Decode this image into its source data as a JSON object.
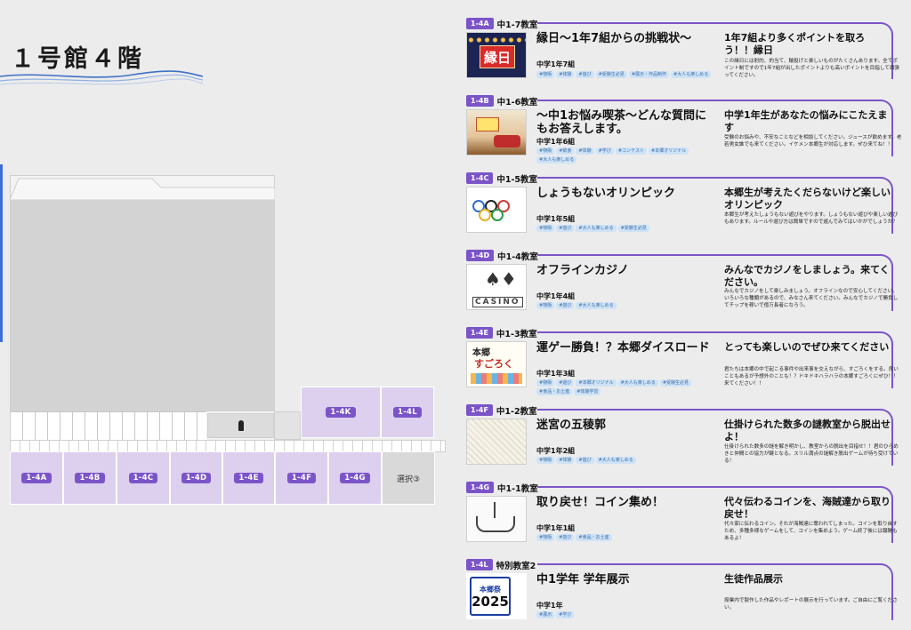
{
  "floor": {
    "title": "１号館４階"
  },
  "map": {
    "rooms_bottom": [
      "1-4A",
      "1-4B",
      "1-4C",
      "1-4D",
      "1-4E",
      "1-4F",
      "1-4G"
    ],
    "rooms_top": [
      "1-4K",
      "1-4L"
    ],
    "selection_room": "選択③"
  },
  "events": [
    {
      "code": "1-4A",
      "room": "中1-7教室",
      "title": "縁日〜1年7組からの挑戦状〜",
      "class": "中学1年7組",
      "tags": [
        "#物販",
        "#体験",
        "#遊び",
        "#受験生必見",
        "#展示・作品制作",
        "#大人も楽しめる"
      ],
      "desc_title": "1年7組より多くポイントを取ろう！！縁日",
      "desc": "この縁日には射的、的当て、輪投げと楽しいものがたくさんあります。全てポイント制ですので1年7組が出したポイントよりも高いポイントを目指して頑張ってください。",
      "thumb_text": "縁日"
    },
    {
      "code": "1-4B",
      "room": "中1-6教室",
      "title": "〜中1お悩み喫茶〜どんな質問にもお答えします。",
      "class": "中学1年6組",
      "tags": [
        "#物販",
        "#飲食",
        "#体験",
        "#学び",
        "#コンテスト",
        "#本郷オリジナル",
        "#大人も楽しめる"
      ],
      "desc_title": "中学1年生があなたの悩みにこたえます",
      "desc": "受験のお悩みや、不安なことなどを相談してください。ジュースが飲めます。老若男女誰でも来てください。イケメン本郷生が対応します。ぜひ来てね！！"
    },
    {
      "code": "1-4C",
      "room": "中1-5教室",
      "title": "しょうもないオリンピック",
      "class": "中学1年5組",
      "tags": [
        "#物販",
        "#遊び",
        "#大人も楽しめる",
        "#受験生必見"
      ],
      "desc_title": "本郷生が考えたくだらないけど楽しいオリンピック",
      "desc": "本郷生が考えたしょうもない遊びをやります。しょうもない遊びや楽しい遊びもあります。ルールや遊び方は簡単ですので遊んでみてはいかがでしょうか？"
    },
    {
      "code": "1-4D",
      "room": "中1-4教室",
      "title": "オフラインカジノ",
      "class": "中学1年4組",
      "tags": [
        "#物販",
        "#遊び",
        "#大人も楽しめる"
      ],
      "desc_title": "みんなでカジノをしましょう。来てください。",
      "desc": "みんなでカジノをして楽しみましょう。オフラインなので安心してください。いろいろな種類があるので、みなさん来てください。みんなでカジノで勝負してチップを稼いで億万長者になろう。",
      "thumb_text": "CASINO"
    },
    {
      "code": "1-4E",
      "room": "中1-3教室",
      "title": "運ゲー勝負！？本郷ダイスロード",
      "class": "中学1年3組",
      "tags": [
        "#物販",
        "#遊び",
        "#本郷オリジナル",
        "#大人も楽しめる",
        "#受験生必見",
        "#食品・お土産",
        "#体験学習"
      ],
      "desc_title": "とっても楽しいのでぜひ来てください",
      "desc": "君たちは本郷の中で起こる事件や出来事を交えながら、すごろくをする。良いこともあるが予想外のことも！？ドキドキハラハラの本郷すごろくにぜひ！！来てください！！",
      "thumb_a": "本郷",
      "thumb_b": "すごろく"
    },
    {
      "code": "1-4F",
      "room": "中1-2教室",
      "title": "迷宮の五稜郭",
      "class": "中学1年2組",
      "tags": [
        "#物販",
        "#体験",
        "#遊び",
        "#大人も楽しめる"
      ],
      "desc_title": "仕掛けられた数多の謎教室から脱出せよ！",
      "desc": "仕掛けられた数多の謎を解き明かし、教室からの脱出を目指せ！！君のひらめきと仲間との協力が鍵となる。スリル満点の謎解き脱出ゲームが待ち受けている！"
    },
    {
      "code": "1-4G",
      "room": "中1-1教室",
      "title": "取り戻せ！コイン集め！",
      "class": "中学1年1組",
      "tags": [
        "#物販",
        "#遊び",
        "#食品・お土産"
      ],
      "desc_title": "代々伝わるコインを、海賊達から取り戻せ！",
      "desc": "代々家に伝わるコイン。それが海賊達に奪われてしまった。コインを取り戻すため、多種多様なゲームをして、コインを集めよう。ゲーム終了後には報酬もあるよ！"
    },
    {
      "code": "1-4L",
      "room": "特別教室2",
      "title": "中1学年 学年展示",
      "class": "中学1年",
      "tags": [
        "#展示",
        "#学び"
      ],
      "desc_title": "生徒作品展示",
      "desc": "授業内で製作した作品やレポートの展示を行っています。ご自由にご覧ください。",
      "logo_a": "本郷祭",
      "logo_b": "2025"
    }
  ]
}
